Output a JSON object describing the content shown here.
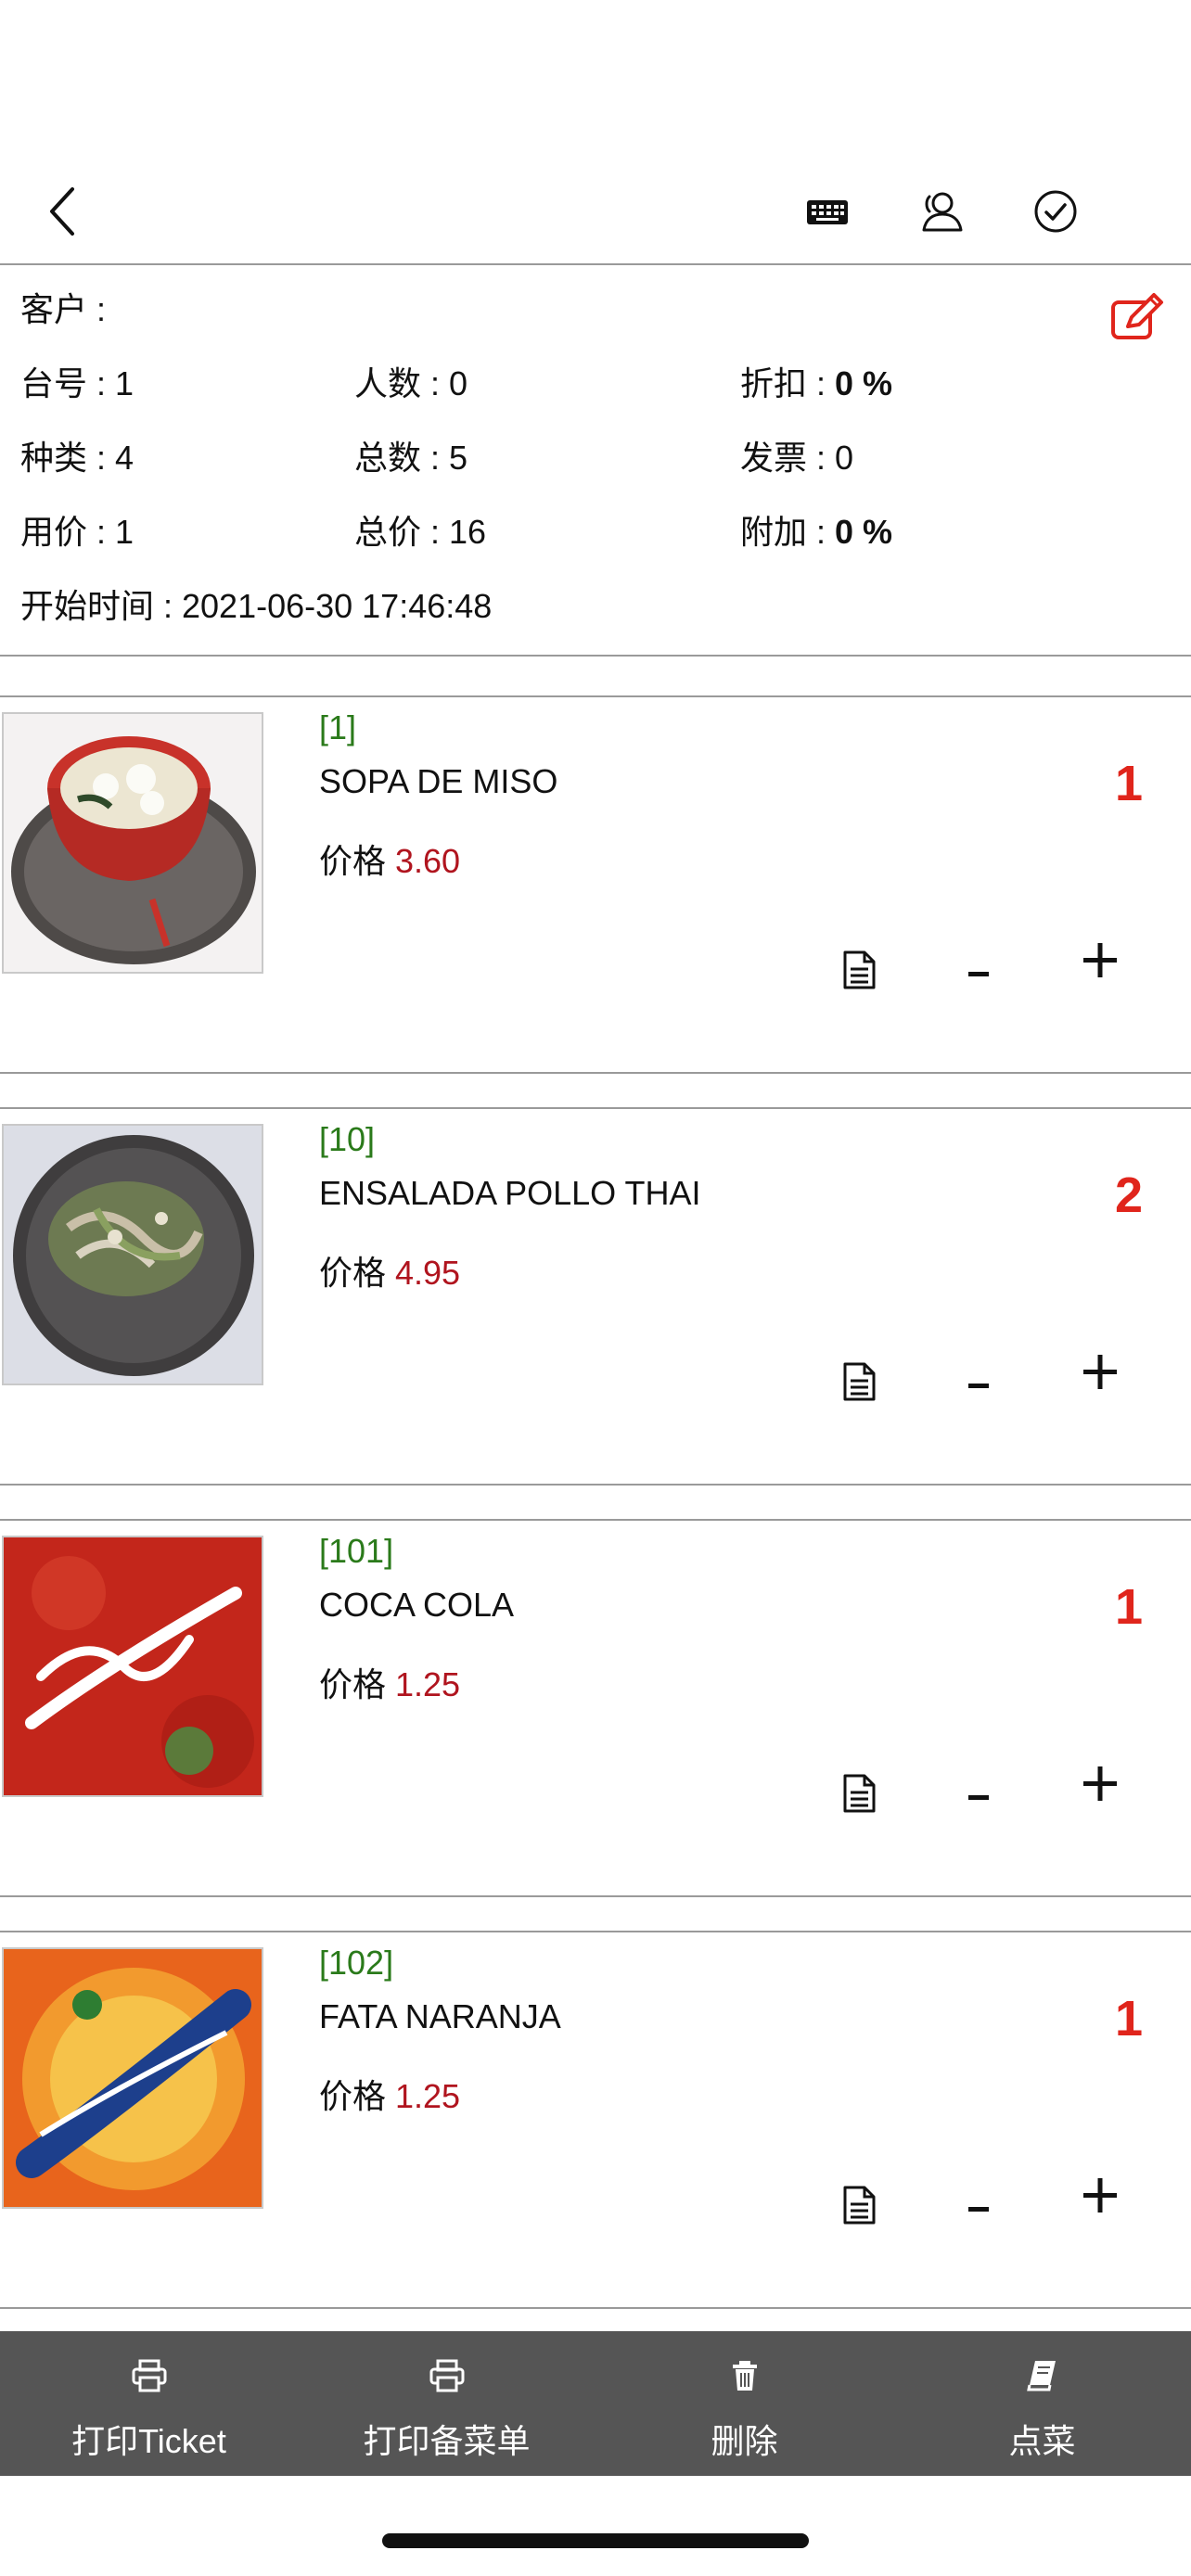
{
  "nav": {
    "icons": [
      "chevron-left-icon",
      "keyboard-icon",
      "user-icon",
      "check-circle-icon"
    ]
  },
  "info": {
    "customer": "客户 :",
    "table": "台号 : 1",
    "people": "人数 : 0",
    "discount_label": "折扣 :",
    "discount_value": "0 %",
    "kinds": "种类 : 4",
    "total_count": "总数 : 5",
    "invoice": "发票 : 0",
    "cost": "用价 : 1",
    "total_price": "总价 : 16",
    "extra_label": "附加 :",
    "extra_value": "0 %",
    "start_time": "开始时间 : 2021-06-30 17:46:48",
    "edit_icon": "edit-icon",
    "accent_color": "#e0251c"
  },
  "items": [
    {
      "code": "[1]",
      "name": "SOPA DE MISO",
      "price_label": "价格",
      "price": "3.60",
      "qty": "1",
      "minus": "-",
      "plus": "+"
    },
    {
      "code": "[10]",
      "name": "ENSALADA POLLO THAI",
      "price_label": "价格",
      "price": "4.95",
      "qty": "2",
      "minus": "-",
      "plus": "+"
    },
    {
      "code": "[101]",
      "name": "COCA COLA",
      "price_label": "价格",
      "price": "1.25",
      "qty": "1",
      "minus": "-",
      "plus": "+"
    },
    {
      "code": "[102]",
      "name": "FATA NARANJA",
      "price_label": "价格",
      "price": "1.25",
      "qty": "1",
      "minus": "-",
      "plus": "+"
    }
  ],
  "bottom_bar": {
    "print_ticket": "打印Ticket",
    "print_kitchen": "打印备菜单",
    "delete": "删除",
    "order": "点菜"
  }
}
